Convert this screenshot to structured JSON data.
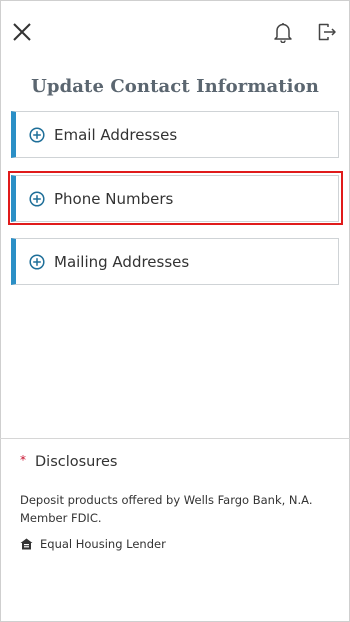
{
  "header": {
    "close_icon": "close-icon",
    "bell_icon": "bell-icon",
    "signout_icon": "sign-out-icon"
  },
  "page": {
    "title": "Update Contact Information"
  },
  "sections": [
    {
      "label": "Email Addresses",
      "icon": "plus-circle-icon"
    },
    {
      "label": "Phone Numbers",
      "icon": "plus-circle-icon"
    },
    {
      "label": "Mailing Addresses",
      "icon": "plus-circle-icon"
    }
  ],
  "footer": {
    "asterisk": "*",
    "disclosures_label": "Disclosures",
    "deposit_text": "Deposit products offered by Wells Fargo Bank, N.A. Member FDIC.",
    "equal_housing_text": "Equal Housing Lender"
  },
  "colors": {
    "accent": "#2b8fc6",
    "highlight": "#e01b1b",
    "asterisk": "#c8102e"
  }
}
